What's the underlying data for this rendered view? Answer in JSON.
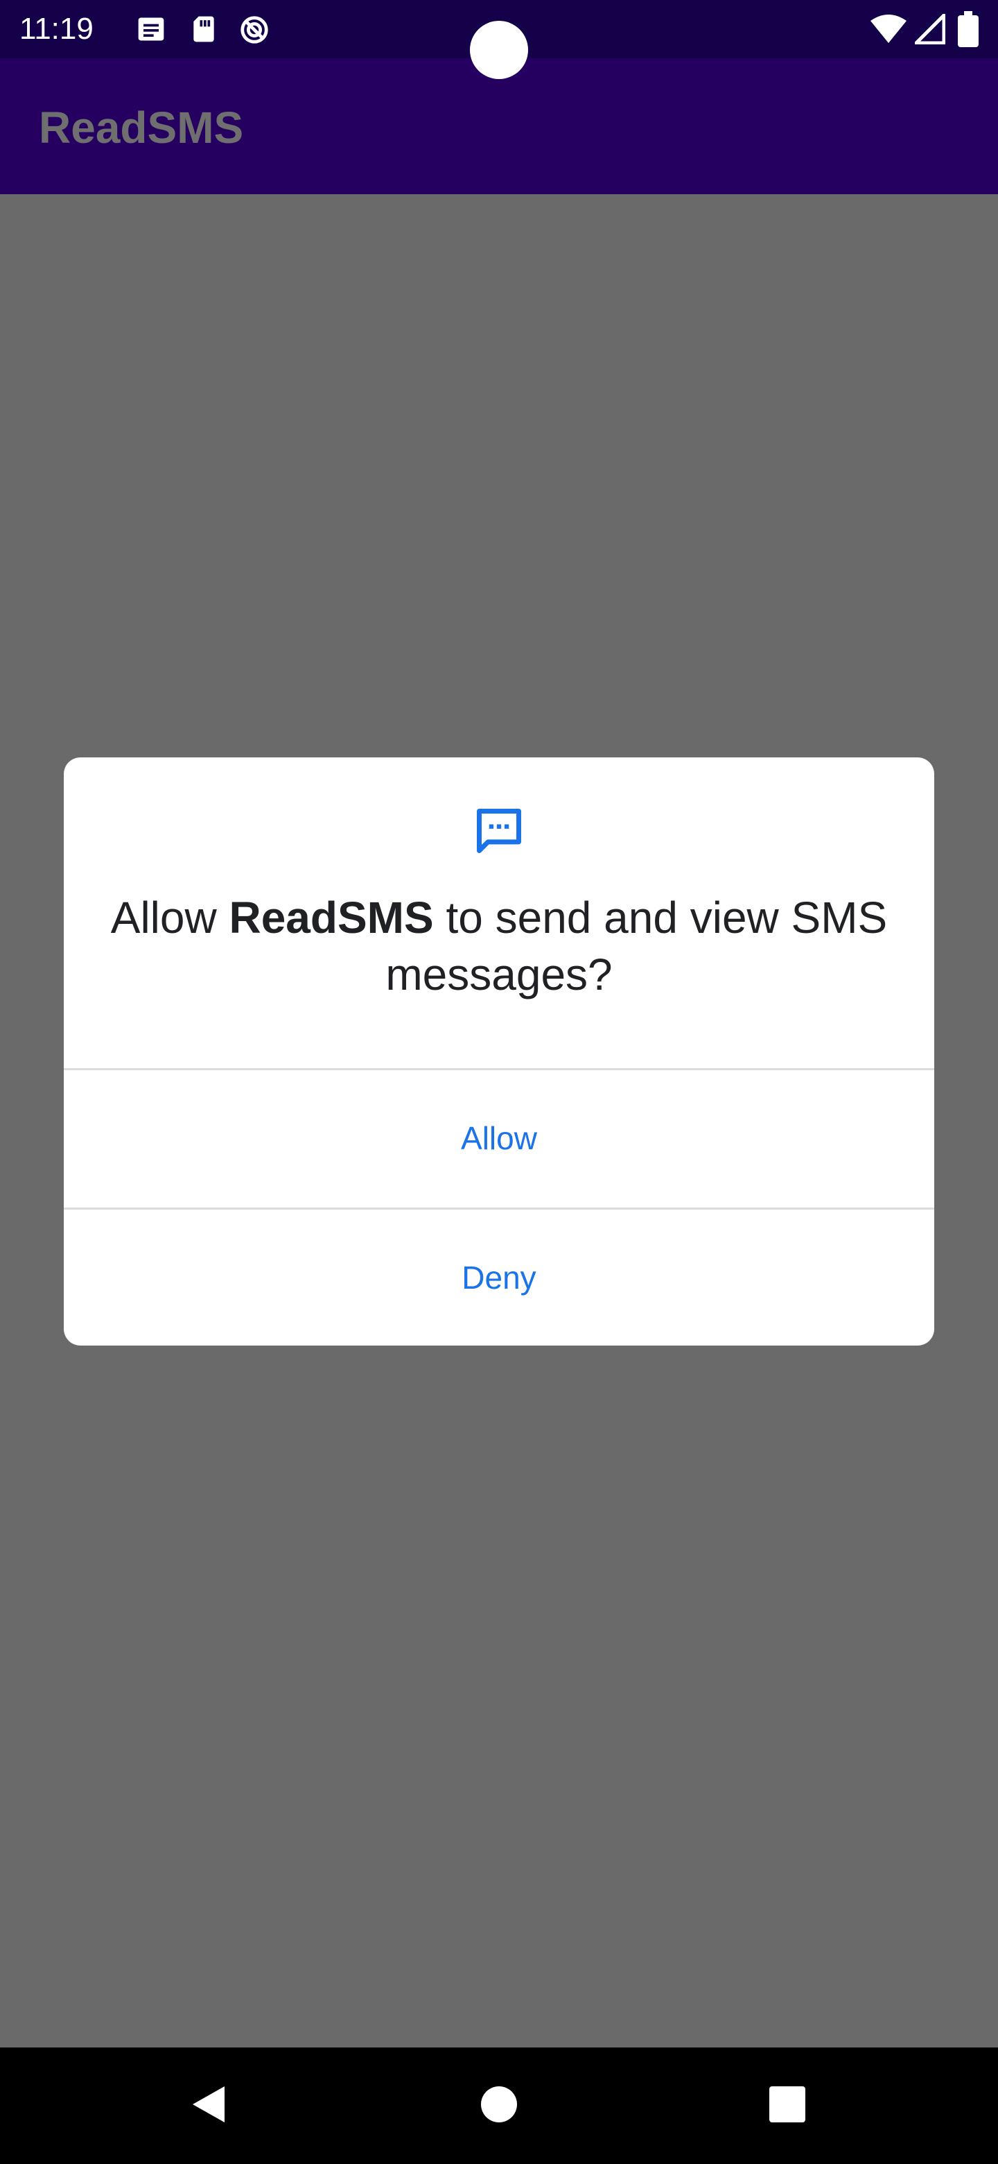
{
  "status_bar": {
    "time": "11:19",
    "left_icons": [
      "message-notification-icon",
      "sd-card-icon",
      "do-not-disturb-icon"
    ],
    "right_icons": [
      "wifi-icon",
      "cell-signal-icon",
      "battery-icon"
    ]
  },
  "app_bar": {
    "title": "ReadSMS"
  },
  "dialog": {
    "icon": "sms-icon",
    "message_prefix": "Allow ",
    "message_app": "ReadSMS",
    "message_suffix": " to send and view SMS messages?",
    "allow_label": "Allow",
    "deny_label": "Deny"
  },
  "nav_bar": {
    "back": "back-icon",
    "home": "home-icon",
    "recents": "recents-icon"
  },
  "colors": {
    "status_bar": "#15004a",
    "app_bar": "#260061",
    "scrim": "#6a6a6a",
    "dialog_button_text": "#1a73e8",
    "dialog_text": "#202124"
  }
}
